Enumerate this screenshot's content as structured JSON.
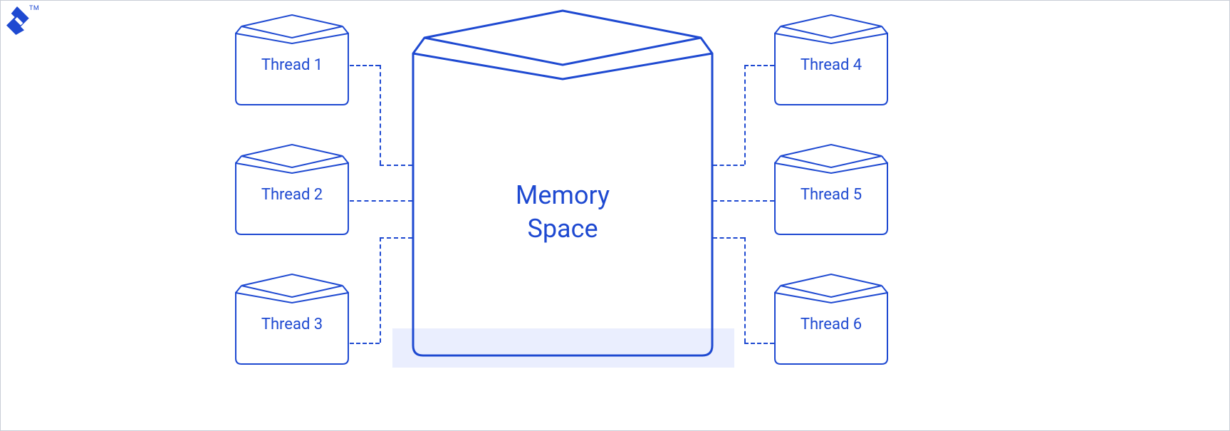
{
  "logo_trademark": "TM",
  "center": {
    "label_line1": "Memory",
    "label_line2": "Space"
  },
  "threads": {
    "left": [
      {
        "label": "Thread 1"
      },
      {
        "label": "Thread 2"
      },
      {
        "label": "Thread 3"
      }
    ],
    "right": [
      {
        "label": "Thread 4"
      },
      {
        "label": "Thread 5"
      },
      {
        "label": "Thread 6"
      }
    ]
  },
  "colors": {
    "stroke": "#1e49d1",
    "dash": "#1e49d1",
    "shadow": "#eaeefe",
    "border": "#c9ced6"
  }
}
